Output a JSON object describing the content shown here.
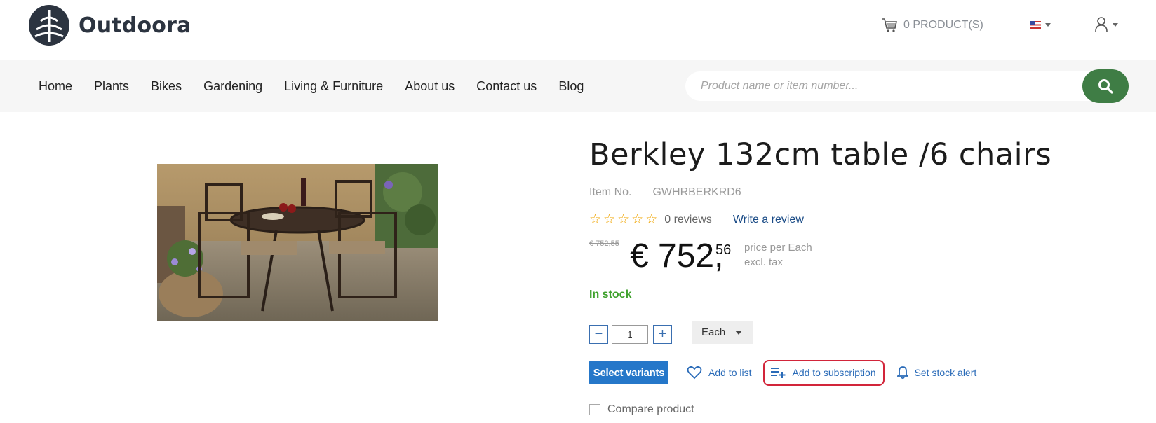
{
  "brand": {
    "name": "Outdoora"
  },
  "header": {
    "cart_label": "0 PRODUCT(S)"
  },
  "nav": {
    "items": [
      "Home",
      "Plants",
      "Bikes",
      "Gardening",
      "Living & Furniture",
      "About us",
      "Contact us",
      "Blog"
    ]
  },
  "search": {
    "placeholder": "Product name or item number..."
  },
  "product": {
    "title": "Berkley 132cm table /6 chairs",
    "item_no_label": "Item No.",
    "item_no": "GWHRBERKRD6",
    "stars": [
      "☆",
      "☆",
      "☆",
      "☆",
      "☆"
    ],
    "reviews": "0 reviews",
    "write_review": "Write a review",
    "old_price": "€ 752,55",
    "price_main": "€ 752,",
    "price_decimals": "56",
    "price_note_1": "price per Each",
    "price_note_2": "excl. tax",
    "stock": "In stock",
    "quantity": "1",
    "minus": "−",
    "plus": "+",
    "unit": "Each"
  },
  "actions": {
    "select_variants": "Select variants",
    "add_to_list": "Add to list",
    "add_to_subscription": "Add to subscription",
    "stock_alert": "Set stock alert",
    "compare": "Compare product"
  },
  "colors": {
    "accent": "#2577c9",
    "search_button": "#3f7d45",
    "in_stock": "#3ea12c",
    "highlight": "#d2253a"
  }
}
